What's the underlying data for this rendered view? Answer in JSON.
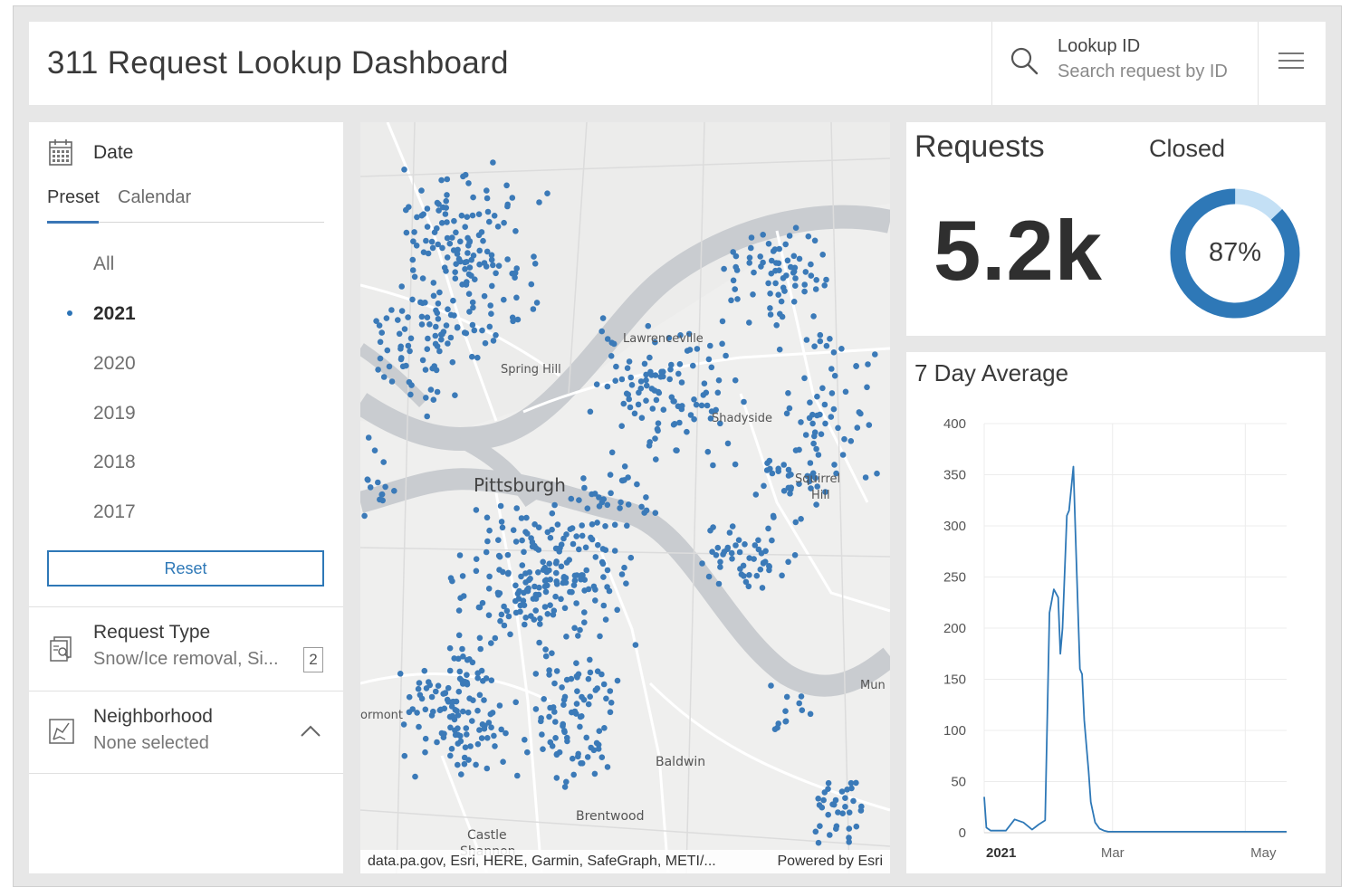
{
  "header": {
    "title": "311 Request Lookup Dashboard",
    "lookup_label": "Lookup ID",
    "lookup_placeholder": "Search request by ID"
  },
  "date_filter": {
    "label": "Date",
    "tabs": [
      {
        "label": "Preset",
        "active": true
      },
      {
        "label": "Calendar",
        "active": false
      }
    ],
    "options": [
      "All",
      "2021",
      "2020",
      "2019",
      "2018",
      "2017"
    ],
    "selected": "2021",
    "reset_label": "Reset"
  },
  "request_type": {
    "title": "Request Type",
    "value": "Snow/Ice removal, Si...",
    "count": "2"
  },
  "neighborhood": {
    "title": "Neighborhood",
    "value": "None selected"
  },
  "map": {
    "labels": [
      "Lawrenceville",
      "Spring Hill",
      "Shadyside",
      "Pittsburgh",
      "Squirrel",
      "Hill",
      "Mun",
      "ormont",
      "Baldwin",
      "Brentwood",
      "Castle",
      "Shannon"
    ],
    "attribution": "data.pa.gov, Esri, HERE, Garmin, SafeGraph, METI/...",
    "powered_by": "Powered by Esri",
    "point_color": "#3b7ab8"
  },
  "kpi": {
    "title": "Requests",
    "value": "5.2k",
    "closed_label": "Closed",
    "closed_percent": 87,
    "closed_text": "87%",
    "ring_color": "#2e78b7",
    "ring_track_color": "#c4e0f5"
  },
  "chart_data": {
    "type": "line",
    "title": "7 Day Average",
    "ylim": [
      0,
      400
    ],
    "yticks": [
      0,
      50,
      100,
      150,
      200,
      250,
      300,
      350,
      400
    ],
    "xlabels": [
      "2021",
      "Mar",
      "May"
    ],
    "grid": true,
    "line_color": "#2e78b7",
    "series": [
      {
        "x": [
          "2021-01-01",
          "2021-01-02",
          "2021-01-04",
          "2021-01-07",
          "2021-01-11",
          "2021-01-15",
          "2021-01-19",
          "2021-01-23",
          "2021-01-26",
          "2021-01-29",
          "2021-01-31",
          "2021-02-02",
          "2021-02-04",
          "2021-02-05",
          "2021-02-06",
          "2021-02-08",
          "2021-02-09",
          "2021-02-11",
          "2021-02-12",
          "2021-02-14",
          "2021-02-15",
          "2021-02-16",
          "2021-02-18",
          "2021-02-19",
          "2021-02-21",
          "2021-02-23",
          "2021-02-25",
          "2021-02-27",
          "2021-03-01",
          "2021-03-05",
          "2021-03-15",
          "2021-04-01",
          "2021-04-15",
          "2021-05-01",
          "2021-05-15",
          "2021-05-20"
        ],
        "y": [
          35,
          5,
          2,
          2,
          2,
          13,
          10,
          3,
          8,
          12,
          215,
          238,
          230,
          175,
          200,
          310,
          315,
          358,
          290,
          160,
          155,
          110,
          60,
          30,
          10,
          4,
          2,
          1,
          1,
          1,
          1,
          1,
          1,
          1,
          1,
          1
        ]
      }
    ]
  }
}
